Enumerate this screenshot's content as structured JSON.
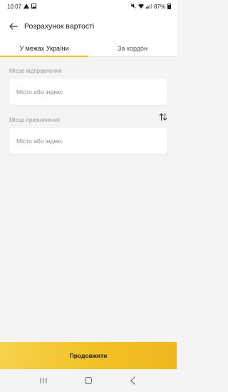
{
  "status_bar": {
    "time": "10:07",
    "battery": "87%",
    "icons": [
      "warning-icon",
      "image-icon",
      "mute-icon",
      "wifi-icon",
      "signal-icon",
      "battery-icon"
    ]
  },
  "header": {
    "title": "Розрахунок вартості",
    "back_icon": "arrow-left-icon"
  },
  "tabs": [
    {
      "label": "У межах України",
      "active": true
    },
    {
      "label": "За кордон",
      "active": false
    }
  ],
  "origin": {
    "label": "Місце відправлення",
    "placeholder": "Місто або індекс",
    "value": ""
  },
  "destination": {
    "label": "Місце призначення",
    "placeholder": "Місто або індекс",
    "value": ""
  },
  "swap_icon": "swap-vertical-icon",
  "continue_button": {
    "label": "Продовжити"
  },
  "colors": {
    "accent": "#f3c220",
    "background": "#f4f4f4",
    "surface": "#ffffff",
    "label_text": "#9a9a9a"
  },
  "nav_bar": [
    "recents-icon",
    "home-icon",
    "back-icon"
  ]
}
